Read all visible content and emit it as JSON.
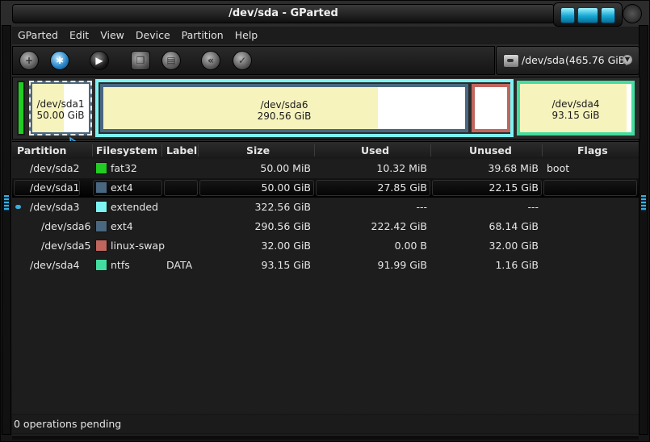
{
  "window": {
    "title": "/dev/sda - GParted"
  },
  "menubar": {
    "items": [
      "GParted",
      "Edit",
      "View",
      "Device",
      "Partition",
      "Help"
    ]
  },
  "toolbar": {
    "buttons": [
      {
        "icon": "new-partition-icon"
      },
      {
        "icon": "delete-partition-icon"
      },
      {
        "icon": "resize-move-icon"
      },
      {
        "icon": "copy-icon"
      },
      {
        "icon": "paste-icon"
      },
      {
        "icon": "undo-icon"
      },
      {
        "icon": "apply-icon"
      }
    ]
  },
  "device": {
    "name": "/dev/sda",
    "size": "(465.76 GiB)"
  },
  "diskmap": {
    "colors": {
      "fat32": "#22cc22",
      "ext4": "#4a6780",
      "extended": "#7ef3f3",
      "linux-swap": "#c0665e",
      "ntfs": "#44dda0",
      "used": "#f6f3bd",
      "unused": "#ffffff"
    },
    "partitions": [
      {
        "name": "/dev/sda2",
        "label": "",
        "size": ""
      },
      {
        "name": "/dev/sda1",
        "size": "50.00 GiB",
        "used_fraction": 0.557
      },
      {
        "name": "/dev/sda6",
        "size": "290.56 GiB",
        "used_fraction": 0.765
      },
      {
        "name": "/dev/sda5",
        "size": "",
        "used_fraction": 0.0
      },
      {
        "name": "/dev/sda4",
        "size": "93.15 GiB",
        "used_fraction": 0.987
      }
    ]
  },
  "table": {
    "columns": [
      "Partition",
      "Filesystem",
      "Label",
      "Size",
      "Used",
      "Unused",
      "Flags"
    ],
    "rows": [
      {
        "partition": "/dev/sda2",
        "filesystem": "fat32",
        "fs_color": "#22cc22",
        "label": "",
        "size": "50.00 MiB",
        "used": "10.32 MiB",
        "unused": "39.68 MiB",
        "flags": "boot"
      },
      {
        "partition": "/dev/sda1",
        "filesystem": "ext4",
        "fs_color": "#4a6780",
        "label": "",
        "size": "50.00 GiB",
        "used": "27.85 GiB",
        "unused": "22.15 GiB",
        "flags": ""
      },
      {
        "partition": "/dev/sda3",
        "filesystem": "extended",
        "fs_color": "#7ef3f3",
        "label": "",
        "size": "322.56 GiB",
        "used": "---",
        "unused": "---",
        "flags": ""
      },
      {
        "partition": "/dev/sda6",
        "filesystem": "ext4",
        "fs_color": "#4a6780",
        "label": "",
        "size": "290.56 GiB",
        "used": "222.42 GiB",
        "unused": "68.14 GiB",
        "flags": ""
      },
      {
        "partition": "/dev/sda5",
        "filesystem": "linux-swap",
        "fs_color": "#c0665e",
        "label": "",
        "size": "32.00 GiB",
        "used": "0.00 B",
        "unused": "32.00 GiB",
        "flags": ""
      },
      {
        "partition": "/dev/sda4",
        "filesystem": "ntfs",
        "fs_color": "#44dda0",
        "label": "DATA",
        "size": "93.15 GiB",
        "used": "91.99 GiB",
        "unused": "1.16 GiB",
        "flags": ""
      }
    ]
  },
  "status": {
    "text": "0 operations pending"
  }
}
